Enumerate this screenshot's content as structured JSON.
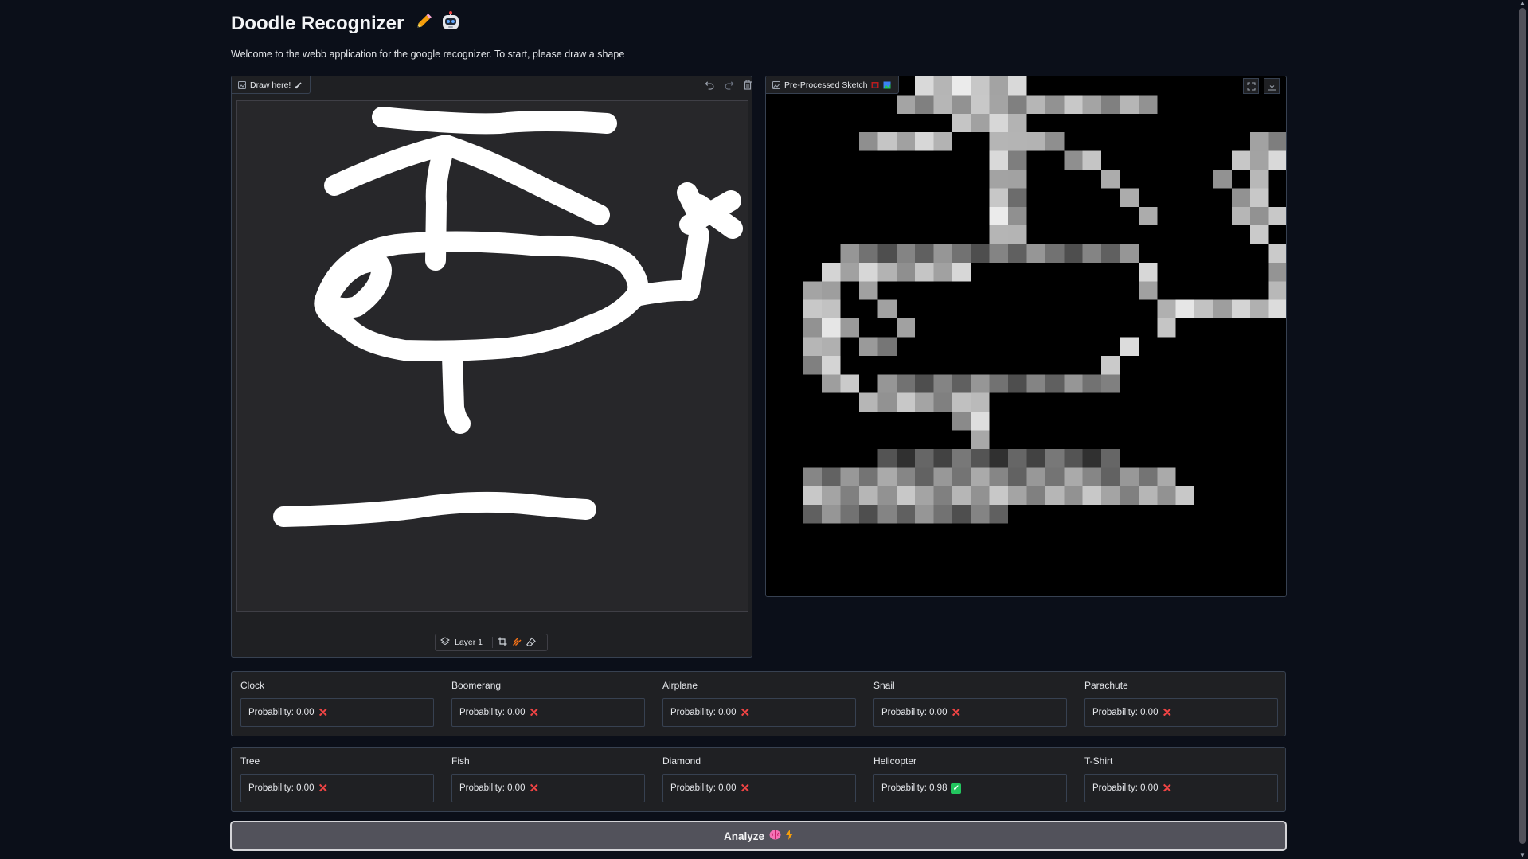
{
  "header": {
    "title": "Doodle Recognizer",
    "title_icons": [
      "pencil-icon",
      "robot-icon"
    ],
    "subtitle": "Welcome to the webb application for the google recognizer. To start, please draw a shape"
  },
  "draw_panel": {
    "label": "Draw here!",
    "layer_label": "Layer 1"
  },
  "preview_panel": {
    "label": "Pre-Processed Sketch"
  },
  "predictions_row1": [
    {
      "label": "Clock",
      "value": "Probability: 0.00",
      "status": "cross"
    },
    {
      "label": "Boomerang",
      "value": "Probability: 0.00",
      "status": "cross"
    },
    {
      "label": "Airplane",
      "value": "Probability: 0.00",
      "status": "cross"
    },
    {
      "label": "Snail",
      "value": "Probability: 0.00",
      "status": "cross"
    },
    {
      "label": "Parachute",
      "value": "Probability: 0.00",
      "status": "cross"
    }
  ],
  "predictions_row2": [
    {
      "label": "Tree",
      "value": "Probability: 0.00",
      "status": "cross"
    },
    {
      "label": "Fish",
      "value": "Probability: 0.00",
      "status": "cross"
    },
    {
      "label": "Diamond",
      "value": "Probability: 0.00",
      "status": "cross"
    },
    {
      "label": "Helicopter",
      "value": "Probability: 0.98",
      "status": "check"
    },
    {
      "label": "T-Shirt",
      "value": "Probability: 0.00",
      "status": "cross"
    }
  ],
  "analyze_button": {
    "label": "Analyze"
  },
  "colors": {
    "background": "#0b0f19",
    "panel": "#1f2023",
    "border": "#374151",
    "cross": "#ef4444",
    "check": "#22c55e",
    "button": "#52525b"
  }
}
